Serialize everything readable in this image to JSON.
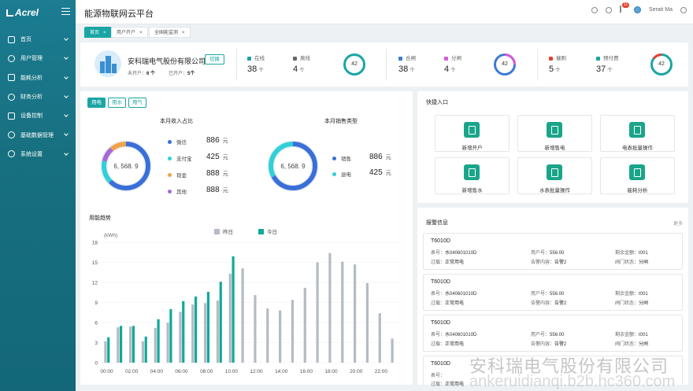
{
  "app": {
    "logo": "Acrel",
    "title": "能源物联网云平台",
    "user": "Serati Ma",
    "badge_count": "11"
  },
  "sidebar": {
    "items": [
      {
        "label": "首页",
        "icon": "grid-icon"
      },
      {
        "label": "用户管理",
        "icon": "user-icon"
      },
      {
        "label": "能耗分析",
        "icon": "chart-icon"
      },
      {
        "label": "财务分析",
        "icon": "money-icon"
      },
      {
        "label": "设备控制",
        "icon": "device-icon"
      },
      {
        "label": "基础数据管理",
        "icon": "database-icon"
      },
      {
        "label": "系统设置",
        "icon": "gear-icon"
      }
    ]
  },
  "tabs": [
    {
      "label": "首页"
    },
    {
      "label": "用户开户"
    },
    {
      "label": "全国能监测"
    }
  ],
  "company": {
    "name": "安科瑞电气股份有限公司",
    "switch_label": "切换",
    "unopened_label": "未开户：",
    "unopened": "6 个",
    "opened_label": "已开户：",
    "opened": "5个"
  },
  "stats": [
    {
      "label": "在线",
      "value": "38",
      "unit": "个",
      "color": "#1aa5a5"
    },
    {
      "label": "离线",
      "value": "4",
      "unit": "个",
      "color": "#666666"
    },
    {
      "label": "合闸",
      "value": "38",
      "unit": "个",
      "color": "#3a7bd5"
    },
    {
      "label": "分闸",
      "value": "4",
      "unit": "个",
      "color": "#d65ad8"
    },
    {
      "label": "催刷",
      "value": "5",
      "unit": "个",
      "color": "#e8402e"
    },
    {
      "label": "预付费",
      "value": "37",
      "unit": "个",
      "color": "#1aa5a5"
    }
  ],
  "rings": [
    "42",
    "42",
    "42"
  ],
  "utility_tabs": [
    "用电",
    "用水",
    "用气"
  ],
  "income": {
    "title": "本月收入占比",
    "center": "6, 568. 9",
    "items": [
      {
        "label": "微信",
        "value": "886",
        "unit": "元",
        "color": "#3a6fd8"
      },
      {
        "label": "支付宝",
        "value": "425",
        "unit": "元",
        "color": "#2fd0d8"
      },
      {
        "label": "现金",
        "value": "888",
        "unit": "元",
        "color": "#f0a34a"
      },
      {
        "label": "其他",
        "value": "888",
        "unit": "元",
        "color": "#a569d8"
      }
    ]
  },
  "sales": {
    "title": "本月销售类型",
    "center": "6, 568. 9",
    "items": [
      {
        "label": "销售",
        "value": "886",
        "unit": "元",
        "color": "#3a6fd8"
      },
      {
        "label": "退电",
        "value": "425",
        "unit": "元",
        "color": "#2fd0d8"
      }
    ]
  },
  "trend": {
    "title": "用能趋势"
  },
  "quick": {
    "title": "快捷入口",
    "items": [
      "新增开户",
      "新增售电",
      "电表批量操作",
      "新增售水",
      "水表批量操作",
      "能耗分析"
    ]
  },
  "alarms": {
    "title": "报警信息",
    "more": "更多",
    "items": [
      {
        "id": "T6010D",
        "meter_label": "表号：",
        "meter": "水040601010D",
        "user_label": "用户号：",
        "user": "556.00",
        "bal_label": "剩余金额：",
        "bal": "t001",
        "over_label": "过载：",
        "over": "正常用电",
        "content_label": "告警内容：",
        "content": "告警2",
        "valve_label": "阀门状态：",
        "valve": "分闸"
      },
      {
        "id": "T6010D",
        "meter_label": "表号：",
        "meter": "水040601010D",
        "user_label": "用户号：",
        "user": "556.00",
        "bal_label": "剩余金额：",
        "bal": "t001",
        "over_label": "过载：",
        "over": "正常用电",
        "content_label": "告警内容：",
        "content": "告警2",
        "valve_label": "阀门状态：",
        "valve": "分闸"
      },
      {
        "id": "T6010D",
        "meter_label": "表号：",
        "meter": "水040601010D",
        "user_label": "用户号：",
        "user": "556.00",
        "bal_label": "剩余金额：",
        "bal": "t001",
        "over_label": "过载：",
        "over": "正常用电",
        "content_label": "告警内容：",
        "content": "告警2",
        "valve_label": "阀门状态：",
        "valve": "分闸"
      },
      {
        "id": "T6010D",
        "meter_label": "表号：",
        "meter": "",
        "user_label": "",
        "user": "",
        "bal_label": "",
        "bal": "",
        "over_label": "过载：",
        "over": "正常用电",
        "content_label": "",
        "content": "",
        "valve_label": "",
        "valve": ""
      }
    ]
  },
  "watermark": {
    "line1": "安科瑞电气股份有限公司",
    "line2": "ankeruidianqi.b2b.hc360.com"
  },
  "chart_data": {
    "type": "bar",
    "title": "",
    "ylabel": "(kWh)",
    "ylim": [
      0,
      18
    ],
    "yticks": [
      "0",
      "3",
      "6",
      "9",
      "12",
      "15",
      "18"
    ],
    "xticks": [
      "00:00",
      "02:00",
      "04:00",
      "06:00",
      "08:00",
      "10:00",
      "12:00",
      "14:00",
      "16:00",
      "18:00",
      "20:00",
      "22:00"
    ],
    "series": [
      {
        "name": "昨日",
        "color": "#b4bbc4",
        "values": [
          3.2,
          5.3,
          5.4,
          3.2,
          5.2,
          6.0,
          7.6,
          8.7,
          8.9,
          9.3,
          13.3,
          14.1,
          10.1,
          8.1,
          7.8,
          9.4,
          11.2,
          15.0,
          16.4,
          15.1,
          14.7,
          11.9,
          7.4,
          3.6
        ]
      },
      {
        "name": "今日",
        "color": "#12a89a",
        "values": [
          3.8,
          5.5,
          5.5,
          3.9,
          6.5,
          8.0,
          9.2,
          9.9,
          10.6,
          12.1,
          15.9
        ]
      }
    ]
  }
}
